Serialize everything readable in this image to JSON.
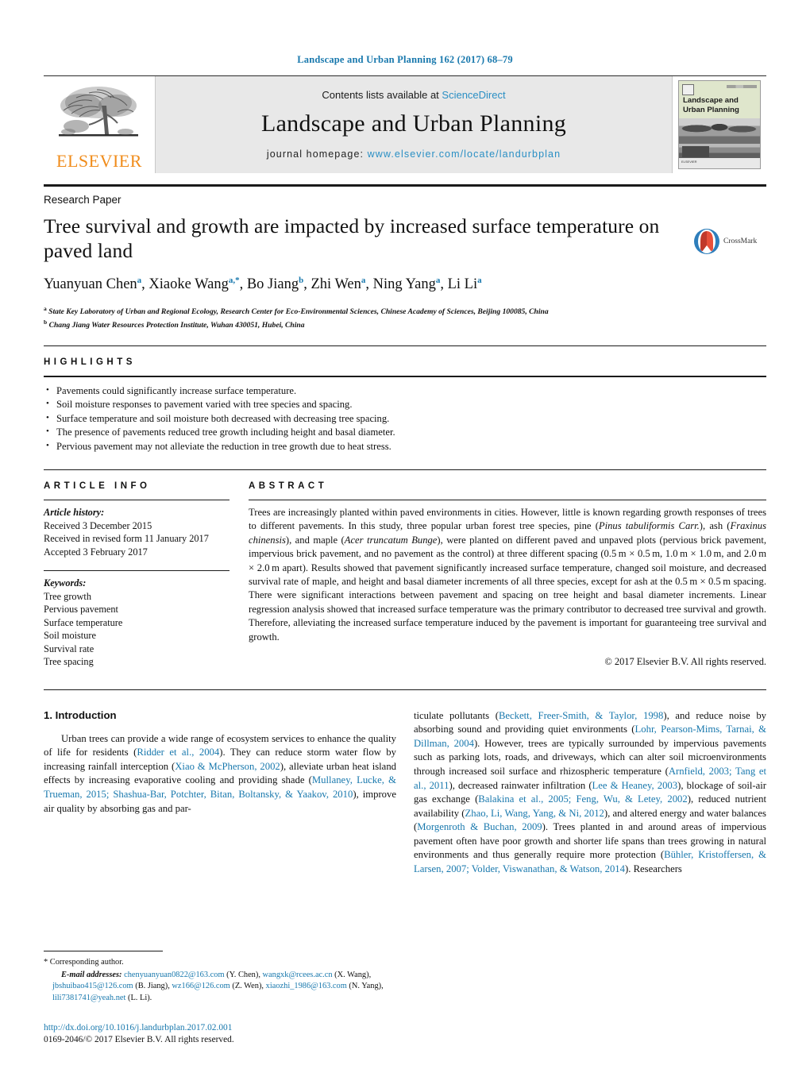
{
  "running_head": "Landscape and Urban Planning 162 (2017) 68–79",
  "masthead": {
    "contents_prefix": "Contents lists available at ",
    "sciencedirect": "ScienceDirect",
    "journal_name": "Landscape and Urban Planning",
    "homepage_prefix": "journal homepage: ",
    "homepage_url": "www.elsevier.com/locate/landurbplan",
    "publisher": "ELSEVIER",
    "cover_title_line1": "Landscape and",
    "cover_title_line2": "Urban Planning",
    "cover_footer": "ELSEVIER",
    "link_color": "#2a8fc4",
    "elsevier_orange": "#f08c1b"
  },
  "article": {
    "kind": "Research Paper",
    "title": "Tree survival and growth are impacted by increased surface temperature on paved land",
    "crossmark_label": "CrossMark",
    "authors_html": "Yuanyuan Chen<sup>a</sup>, Xiaoke Wang<sup>a,*</sup>, Bo Jiang<sup>b</sup>, Zhi Wen<sup>a</sup>, Ning Yang<sup>a</sup>, Li Li<sup>a</sup>",
    "affiliations": [
      "<sup>a</sup> State Key Laboratory of Urban and Regional Ecology, Research Center for Eco-Environmental Sciences, Chinese Academy of Sciences, Beijing 100085, China",
      "<sup>b</sup> Chang Jiang Water Resources Protection Institute, Wuhan 430051, Hubei, China"
    ]
  },
  "highlights": {
    "heading": "HIGHLIGHTS",
    "items": [
      "Pavements could significantly increase surface temperature.",
      "Soil moisture responses to pavement varied with tree species and spacing.",
      "Surface temperature and soil moisture both decreased with decreasing tree spacing.",
      "The presence of pavements reduced tree growth including height and basal diameter.",
      "Pervious pavement may not alleviate the reduction in tree growth due to heat stress."
    ]
  },
  "article_info": {
    "heading": "ARTICLE INFO",
    "history_label": "Article history:",
    "history": [
      "Received 3 December 2015",
      "Received in revised form 11 January 2017",
      "Accepted 3 February 2017"
    ],
    "keywords_label": "Keywords:",
    "keywords": [
      "Tree growth",
      "Pervious pavement",
      "Surface temperature",
      "Soil moisture",
      "Survival rate",
      "Tree spacing"
    ]
  },
  "abstract": {
    "heading": "ABSTRACT",
    "body_html": "Trees are increasingly planted within paved environments in cities. However, little is known regarding growth responses of trees to different pavements. In this study, three popular urban forest tree species, pine (<i>Pinus tabuliformis Carr.</i>), ash (<i>Fraxinus chinensis</i>), and maple (<i>Acer truncatum Bunge</i>), were planted on different paved and unpaved plots (pervious brick pavement, impervious brick pavement, and no pavement as the control) at three different spacing (0.5&#8201;m &#215; 0.5&#8201;m, 1.0&#8201;m &#215; 1.0&#8201;m, and 2.0&#8201;m &#215; 2.0&#8201;m apart). Results showed that pavement significantly increased surface temperature, changed soil moisture, and decreased survival rate of maple, and height and basal diameter increments of all three species, except for ash at the 0.5&#8201;m &#215; 0.5&#8201;m spacing. There were significant interactions between pavement and spacing on tree height and basal diameter increments. Linear regression analysis showed that increased surface temperature was the primary contributor to decreased tree survival and growth. Therefore, alleviating the increased surface temperature induced by the pavement is important for guaranteeing tree survival and growth.",
    "copyright": "© 2017 Elsevier B.V. All rights reserved."
  },
  "introduction": {
    "heading": "1.  Introduction",
    "left_paragraph_html": "Urban trees can provide a wide range of ecosystem services to enhance the quality of life for residents (<span class=\"cite\">Ridder et al., 2004</span>). They can reduce storm water flow by increasing rainfall interception (<span class=\"cite\">Xiao &amp; McPherson, 2002</span>), alleviate urban heat island effects by increasing evaporative cooling and providing shade (<span class=\"cite\">Mullaney, Lucke, &amp; Trueman, 2015; Shashua-Bar, Potchter, Bitan, Boltansky, &amp; Yaakov, 2010</span>), improve air quality by absorbing gas and par-",
    "right_paragraph_html": "ticulate pollutants (<span class=\"cite\">Beckett, Freer-Smith, &amp; Taylor, 1998</span>), and reduce noise by absorbing sound and providing quiet environments (<span class=\"cite\">Lohr, Pearson-Mims, Tarnai, &amp; Dillman, 2004</span>). However, trees are typically surrounded by impervious pavements such as parking lots, roads, and driveways, which can alter soil microenvironments through increased soil surface and rhizospheric temperature (<span class=\"cite\">Arnfield, 2003; Tang et al., 2011</span>), decreased rainwater infiltration (<span class=\"cite\">Lee &amp; Heaney, 2003</span>), blockage of soil-air gas exchange (<span class=\"cite\">Balakina et al., 2005; Feng, Wu, &amp; Letey, 2002</span>), reduced nutrient availability (<span class=\"cite\">Zhao, Li, Wang, Yang, &amp; Ni, 2012</span>), and altered energy and water balances (<span class=\"cite\">Morgenroth &amp; Buchan, 2009</span>). Trees planted in and around areas of impervious pavement often have poor growth and shorter life spans than trees growing in natural environments and thus generally require more protection (<span class=\"cite\">Bühler, Kristoffersen, &amp; Larsen, 2007; Volder, Viswanathan, &amp; Watson, 2014</span>). Researchers"
  },
  "footnotes": {
    "corresponding": "*  Corresponding author.",
    "emails_html": "<i>E-mail addresses:</i> <span class=\"cite\">chenyuanyuan0822@163.com</span> (Y. Chen), <span class=\"cite\">wangxk@rcees.ac.cn</span> (X. Wang), <span class=\"cite\">jbshuibao415@126.com</span> (B. Jiang), <span class=\"cite\">wz166@126.com</span> (Z. Wen), <span class=\"cite\">xiaozhi_1986@163.com</span> (N. Yang), <span class=\"cite\">lili7381741@yeah.net</span> (L. Li).",
    "doi": "http://dx.doi.org/10.1016/j.landurbplan.2017.02.001",
    "issn": "0169-2046/© 2017 Elsevier B.V. All rights reserved."
  }
}
